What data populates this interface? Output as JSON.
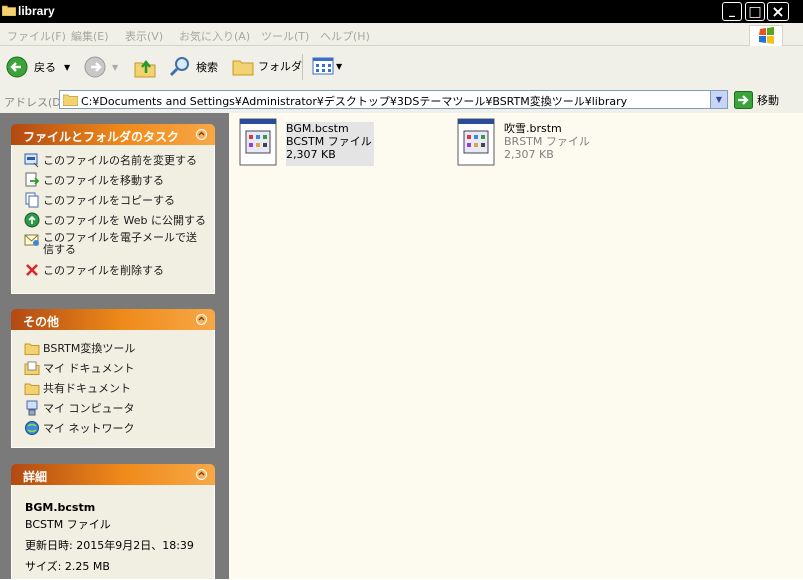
{
  "window": {
    "title": "library",
    "controls": [
      "_",
      "□",
      "×"
    ]
  },
  "menu": {
    "items": [
      "ファイル(F)",
      "編集(E)",
      "表示(V)",
      "お気に入り(A)",
      "ツール(T)",
      "ヘルプ(H)"
    ]
  },
  "toolbar": {
    "back_label": "戻る",
    "search_label": "検索",
    "folders_label": "フォルダ"
  },
  "address": {
    "label": "アドレス(D)",
    "path": "C:¥Documents and Settings¥Administrator¥デスクトップ¥3DSテーマツール¥BSRTM変換ツール¥library",
    "go_label": "移動"
  },
  "tasks_panel": {
    "title": "ファイルとフォルダのタスク",
    "items": [
      {
        "label": "このファイルの名前を変更する",
        "icon": "rename-icon"
      },
      {
        "label": "このファイルを移動する",
        "icon": "move-icon"
      },
      {
        "label": "このファイルをコピーする",
        "icon": "copy-icon"
      },
      {
        "label": "このファイルを Web に公開する",
        "icon": "web-publish-icon"
      },
      {
        "label": "このファイルを電子メールで送信する",
        "icon": "email-icon"
      },
      {
        "label": "このファイルを削除する",
        "icon": "delete-icon"
      }
    ]
  },
  "other_panel": {
    "title": "その他",
    "items": [
      {
        "label": "BSRTM変換ツール",
        "icon": "folder-icon"
      },
      {
        "label": "マイ ドキュメント",
        "icon": "my-documents-icon"
      },
      {
        "label": "共有ドキュメント",
        "icon": "shared-documents-icon"
      },
      {
        "label": "マイ コンピュータ",
        "icon": "my-computer-icon"
      },
      {
        "label": "マイ ネットワーク",
        "icon": "my-network-icon"
      }
    ]
  },
  "details_panel": {
    "title": "詳細",
    "name": "BGM.bcstm",
    "type": "BCSTM ファイル",
    "modified": "更新日時: 2015年9月2日、18:39",
    "size": "サイズ: 2.25 MB"
  },
  "files": [
    {
      "name": "BGM.bcstm",
      "type": "BCSTM ファイル",
      "size": "2,307 KB",
      "selected": true
    },
    {
      "name": "吹雪.brstm",
      "type": "BRSTM ファイル",
      "size": "2,307 KB",
      "selected": false
    }
  ],
  "colors": {
    "panel_header_dark": "#b24a12",
    "panel_header_light": "#ef8a1a",
    "sidebar_bg": "#7a7a7a",
    "content_bg": "#fdfbf0"
  }
}
